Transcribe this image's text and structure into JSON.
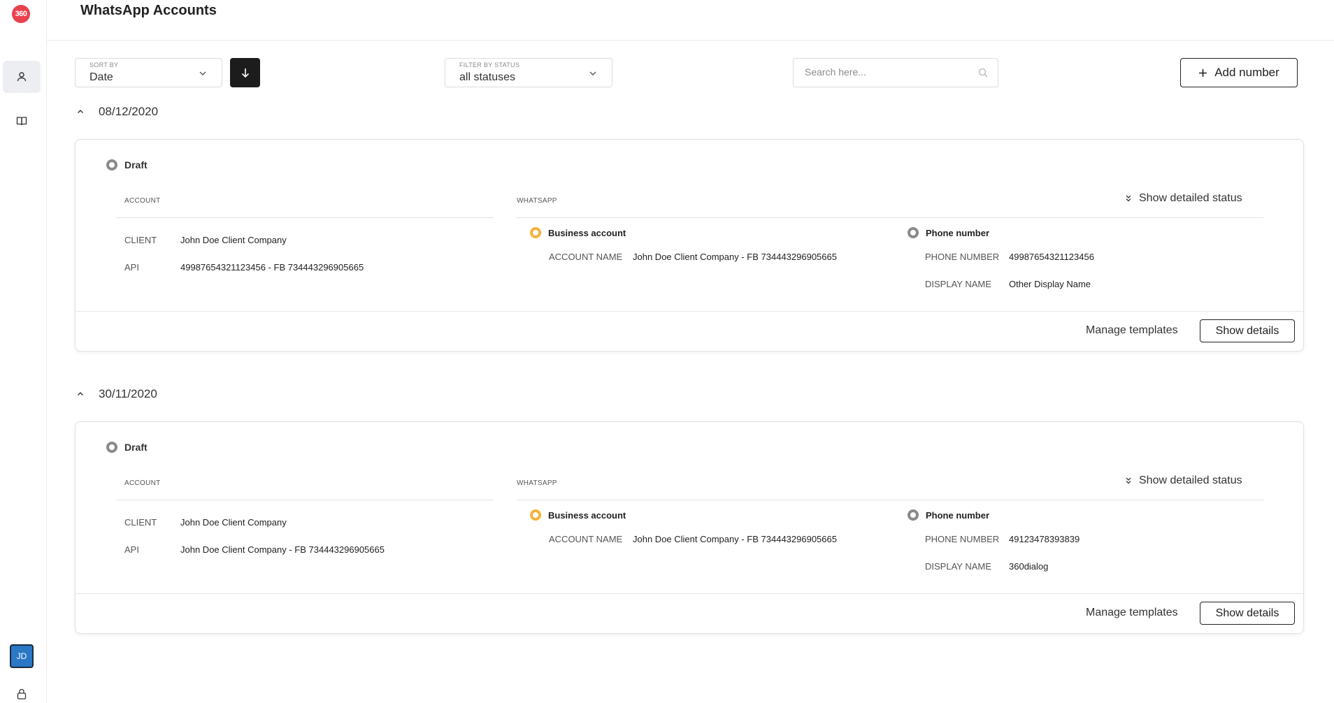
{
  "app": {
    "logo_text": "360",
    "title": "WhatsApp Accounts",
    "brand_color": "#e8424f"
  },
  "sidebar": {
    "items": [
      {
        "icon": "person-icon",
        "active": true
      },
      {
        "icon": "book-icon",
        "active": false
      }
    ],
    "avatar_initials": "JD",
    "bottom_icon": "lock-icon"
  },
  "toolbar": {
    "sort_label": "SORT BY",
    "sort_value": "Date",
    "sort_direction_icon": "arrow-down-icon",
    "filter_label": "FILTER BY STATUS",
    "filter_value": "all statuses",
    "search_placeholder": "Search here...",
    "search_icon": "search-icon",
    "add_label": "Add number",
    "add_icon": "plus-icon"
  },
  "groups": [
    {
      "date": "08/12/2020",
      "card": {
        "status": "Draft",
        "account_section": "ACCOUNT",
        "whatsapp_section": "WHATSAPP",
        "detailed_status_label": "Show detailed status",
        "client_key": "CLIENT",
        "client_value": "John Doe Client Company",
        "api_key": "API",
        "api_value": "49987654321123456 - FB 734443296905665",
        "business_account": {
          "title": "Business account",
          "status_color": "#f5b33c",
          "account_name_key": "ACCOUNT NAME",
          "account_name_value": "John Doe Client Company - FB 734443296905665"
        },
        "phone_number": {
          "title": "Phone number",
          "status_color": "#8a8a8a",
          "phone_key": "PHONE NUMBER",
          "phone_value": "49987654321123456",
          "display_key": "DISPLAY NAME",
          "display_value": "Other Display Name"
        },
        "manage_label": "Manage templates",
        "details_label": "Show details"
      }
    },
    {
      "date": "30/11/2020",
      "card": {
        "status": "Draft",
        "account_section": "ACCOUNT",
        "whatsapp_section": "WHATSAPP",
        "detailed_status_label": "Show detailed status",
        "client_key": "CLIENT",
        "client_value": "John Doe Client Company",
        "api_key": "API",
        "api_value": "John Doe Client Company - FB 734443296905665",
        "business_account": {
          "title": "Business account",
          "status_color": "#f5b33c",
          "account_name_key": "ACCOUNT NAME",
          "account_name_value": "John Doe Client Company - FB 734443296905665"
        },
        "phone_number": {
          "title": "Phone number",
          "status_color": "#8a8a8a",
          "phone_key": "PHONE NUMBER",
          "phone_value": "49123478393839",
          "display_key": "DISPLAY NAME",
          "display_value": "360dialog"
        },
        "manage_label": "Manage templates",
        "details_label": "Show details"
      }
    }
  ]
}
